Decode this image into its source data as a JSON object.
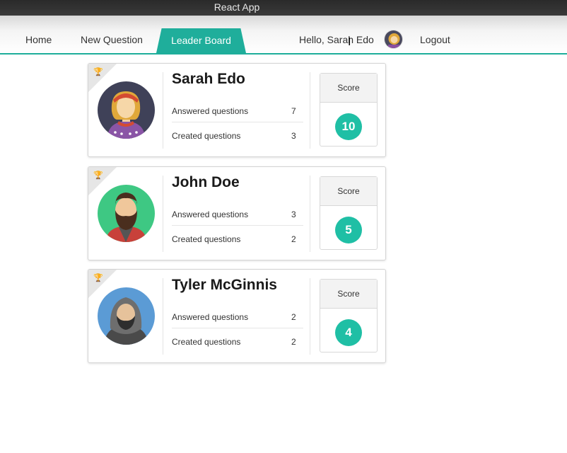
{
  "window": {
    "title": "React App"
  },
  "nav": {
    "home": "Home",
    "new_question": "New Question",
    "leader_board": "Leader Board",
    "greeting": "Hello, Sarah Edo",
    "logout": "Logout"
  },
  "colors": {
    "accent": "#1fae9b",
    "score": "#1fbfa5"
  },
  "leaderboard": [
    {
      "name": "Sarah Edo",
      "answered_label": "Answered questions",
      "answered": "7",
      "created_label": "Created questions",
      "created": "3",
      "score_label": "Score",
      "score": "10",
      "trophy": "gold"
    },
    {
      "name": "John Doe",
      "answered_label": "Answered questions",
      "answered": "3",
      "created_label": "Created questions",
      "created": "2",
      "score_label": "Score",
      "score": "5",
      "trophy": "teal"
    },
    {
      "name": "Tyler McGinnis",
      "answered_label": "Answered questions",
      "answered": "2",
      "created_label": "Created questions",
      "created": "2",
      "score_label": "Score",
      "score": "4",
      "trophy": "gray"
    }
  ]
}
